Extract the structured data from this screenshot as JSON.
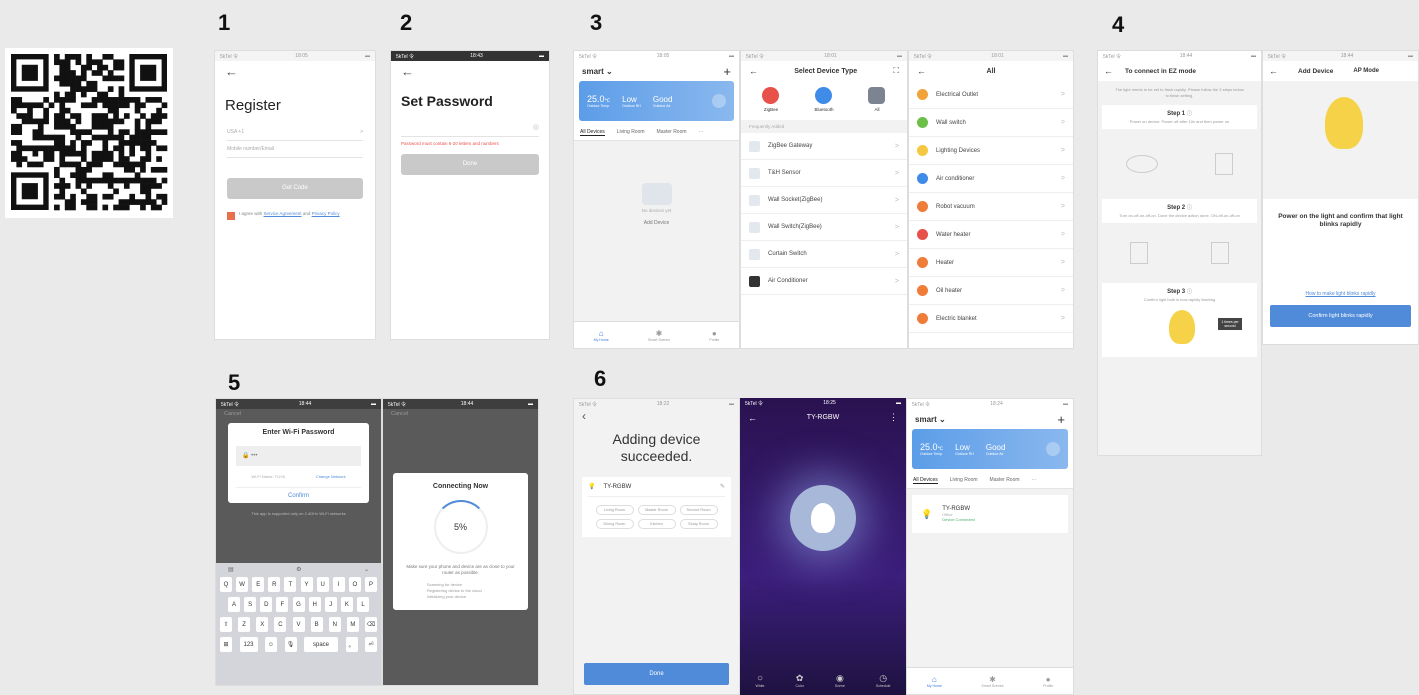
{
  "steps": {
    "s1": "1",
    "s2": "2",
    "s3": "3",
    "s4": "4",
    "s5": "5",
    "s6": "6"
  },
  "register": {
    "status_left": "5kTel 令",
    "status_time": "18:05",
    "back": "←",
    "title": "Register",
    "country": "USA +1",
    "country_arrow": ">",
    "input_placeholder": "Mobile number/Email",
    "button": "Get Code",
    "agree_prefix": "I agree with",
    "agree_service": "Service Agreement",
    "agree_mid": "and",
    "agree_privacy": "Privacy Policy"
  },
  "set_password": {
    "status_left": "5kTel 令",
    "status_time": "18:43",
    "back": "←",
    "title": "Set Password",
    "hint": "Password must contain 6-20 letters and numbers",
    "button": "Done"
  },
  "home": {
    "status_left": "5kTel 令",
    "status_time": "18:05",
    "title": "smart",
    "title_arrow": "⌄",
    "add": "+",
    "temp": "25.0",
    "temp_unit": "℃",
    "temp_label": "Outdoor Temp.",
    "hum": "Low",
    "hum_label": "Outdoor RH",
    "air": "Good",
    "air_label": "Outdoor Air",
    "tabs": [
      "All Devices",
      "Living Room",
      "Master Room"
    ],
    "tabs_more": "⋯",
    "no_device": "No devices yet",
    "add_device": "Add Device",
    "nav": [
      "My Home",
      "Smart Scenes",
      "Profile"
    ]
  },
  "select_type": {
    "status_left": "5kTel 令",
    "status_time": "18:01",
    "back": "←",
    "title": "Select Device Type",
    "scan": "⛶",
    "protocols": [
      {
        "label": "ZigBee",
        "color": "#e8504a"
      },
      {
        "label": "Bluetooth",
        "color": "#3f8be8"
      },
      {
        "label": "All",
        "color": "#7d8491"
      }
    ],
    "section": "Frequently Added",
    "items": [
      "ZigBee Gateway",
      "T&H Sensor",
      "Wall Socket(ZigBee)",
      "Wall Switch(ZigBee)",
      "Curtain Switch",
      "Air Conditioner"
    ],
    "chev": ">"
  },
  "all_devices": {
    "status_left": "5kTel 令",
    "status_time": "18:01",
    "back": "←",
    "title": "All",
    "items": [
      {
        "label": "Electrical Outlet",
        "color": "#f2a23a"
      },
      {
        "label": "Wall switch",
        "color": "#6cc04a"
      },
      {
        "label": "Lighting Devices",
        "color": "#f5c842"
      },
      {
        "label": "Air conditioner",
        "color": "#3f8be8"
      },
      {
        "label": "Robot vacuum",
        "color": "#f07c3a"
      },
      {
        "label": "Water heater",
        "color": "#e8504a"
      },
      {
        "label": "Heater",
        "color": "#f07c3a"
      },
      {
        "label": "Oil heater",
        "color": "#f07c3a"
      },
      {
        "label": "Electric blanket",
        "color": "#f07c3a"
      }
    ],
    "chev": ">"
  },
  "ez_mode": {
    "status_left": "5kTel 令",
    "status_time": "18:44",
    "back": "←",
    "title": "To connect in EZ mode",
    "intro": "The light needs to be set to flash rapidly. Please follow the 3 steps below to finish setting.",
    "step1": "Step 1",
    "step1_desc": "Power on device. Power off after 10s and then power on",
    "step2": "Step 2",
    "step2_desc": "Turn on-off-on-off-on. Done the device action done, ON-off-on-off-on",
    "step3": "Step 3",
    "step3_desc": "Confirm light bulb is now rapidly flashing",
    "badge": "1 times per second",
    "step_icon": "ⓘ"
  },
  "add_device": {
    "status_left": "5kTel 令",
    "status_time": "18:44",
    "back": "←",
    "title": "Add Device",
    "ap": "AP Mode",
    "message": "Power on the light and confirm that light blinks rapidly",
    "link": "How to make light blinks rapidly",
    "button": "Confirm light blinks rapidly"
  },
  "wifi": {
    "status_left": "5kTel 令",
    "status_time": "18:44",
    "cancel": "Cancel",
    "title": "Enter Wi-Fi Password",
    "password": "•••",
    "ssid": "Wi-Fi Name: TUYA",
    "change": "Change Network",
    "confirm": "Confirm",
    "note": "This app is supported only on 2.4GHz Wi-Fi networks",
    "kb_tools": [
      "▤",
      "⚙",
      "⌄"
    ],
    "row1": [
      "Q",
      "W",
      "E",
      "R",
      "T",
      "Y",
      "U",
      "I",
      "O",
      "P"
    ],
    "row2": [
      "A",
      "S",
      "D",
      "F",
      "G",
      "H",
      "J",
      "K",
      "L"
    ],
    "row3": [
      "⇧",
      "Z",
      "X",
      "C",
      "V",
      "B",
      "N",
      "M",
      "⌫"
    ],
    "row4": [
      "⊞",
      "123",
      "☺",
      "🎙",
      "space",
      "。",
      "⏎"
    ]
  },
  "connecting": {
    "status_left": "5kTel 令",
    "status_time": "18:44",
    "cancel": "Cancel",
    "title": "Connecting Now",
    "percent": "5%",
    "desc": "Make sure your phone and device are as close to your router as possible.",
    "checks": [
      "Scanning for device",
      "Registering device to the cloud",
      "Initializing your device"
    ]
  },
  "added": {
    "status_left": "5kTel 令",
    "status_time": "18:22",
    "back": "‹",
    "title": "Adding device succeeded.",
    "device": "TY-RGBW",
    "edit": "✎",
    "rooms": [
      "Living Room",
      "Master Room",
      "Second Room",
      "Dining Room",
      "Kitchen",
      "Study Room"
    ],
    "button": "Done"
  },
  "light": {
    "status_left": "5kTel 令",
    "status_time": "18:25",
    "back": "←",
    "title": "TY-RGBW",
    "menu": "⋮",
    "nav": [
      "White",
      "Color",
      "Scene",
      "Schedule"
    ]
  },
  "home2": {
    "status_left": "5kTel 令",
    "status_time": "18:24",
    "title": "smart",
    "title_arrow": "⌄",
    "add": "+",
    "temp": "25.0",
    "temp_unit": "℃",
    "temp_label": "Outdoor Temp.",
    "hum": "Low",
    "hum_label": "Outdoor RH",
    "air": "Good",
    "air_label": "Outdoor Air",
    "tabs": [
      "All Devices",
      "Living Room",
      "Master Room"
    ],
    "tabs_more": "⋯",
    "device": "TY-RGBW",
    "device_room": "Office",
    "device_status": "Device Connected",
    "nav": [
      "My Home",
      "Smart Scenes",
      "Profile"
    ]
  }
}
